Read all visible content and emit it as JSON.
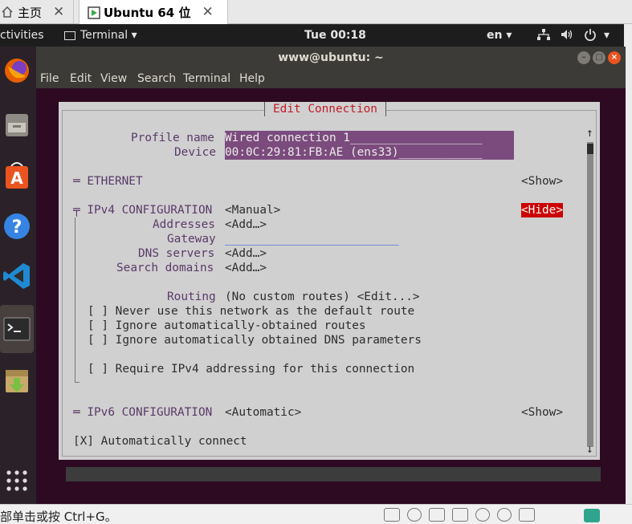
{
  "host": {
    "tabs": [
      {
        "label": "主页",
        "icon": "home-icon"
      },
      {
        "label": "Ubuntu 64 位",
        "icon": "vm-icon"
      }
    ],
    "close_glyph": "✕",
    "status_text": "部单击或按 Ctrl+G。"
  },
  "topbar": {
    "activities": "ctivities",
    "app_menu": "Terminal ▾",
    "clock": "Tue 00:18",
    "input_source": "en ▾",
    "power_arrow": "▾"
  },
  "dock": {
    "items": [
      "firefox-icon",
      "files-icon",
      "software-icon",
      "help-icon",
      "vscode-icon",
      "terminal-icon",
      "archive-install-icon",
      "show-apps-icon"
    ],
    "active": "terminal-icon"
  },
  "window": {
    "title": "www@ubuntu: ~",
    "menu": [
      "File",
      "Edit",
      "View",
      "Search",
      "Terminal",
      "Help"
    ]
  },
  "dialog": {
    "title": "Edit Connection",
    "profile_name_label": "Profile name",
    "profile_name_value": "Wired connection 1___________________",
    "device_label": "Device",
    "device_value": "00:0C:29:81:FB:AE (ens33)____________",
    "ethernet_label": "═ ETHERNET",
    "ethernet_btn": "<Show>",
    "ipv4_label": "╤ IPv4 CONFIGURATION",
    "ipv4_mode": "<Manual>",
    "ipv4_btn": "<Hide>",
    "addresses_label": "Addresses",
    "addresses_btn": "<Add…>",
    "gateway_label": "Gateway",
    "gateway_value": "_________________________",
    "dns_label": "DNS servers",
    "dns_btn": "<Add…>",
    "search_label": "Search domains",
    "search_btn": "<Add…>",
    "routing_label": "Routing",
    "routing_value": "(No custom routes) <Edit...>",
    "cb_never_default": "[ ] Never use this network as the default route",
    "cb_ignore_routes": "[ ] Ignore automatically-obtained routes",
    "cb_ignore_dns": "[ ] Ignore automatically obtained DNS parameters",
    "cb_require_ipv4": "[ ] Require IPv4 addressing for this connection",
    "ipv6_label": "═ IPv6 CONFIGURATION",
    "ipv6_mode": "<Automatic>",
    "ipv6_btn": "<Show>",
    "auto_connect": "[X] Automatically connect",
    "scroll_up": "↑",
    "scroll_down": "↓"
  },
  "colors": {
    "terminal_bg": "#2d0a22",
    "dialog_bg": "#d0d0d0",
    "field_bg": "#7b4b7d",
    "title_red": "#c01c28",
    "hide_btn_bg": "#cc0000",
    "ubuntu_orange": "#e95420"
  }
}
